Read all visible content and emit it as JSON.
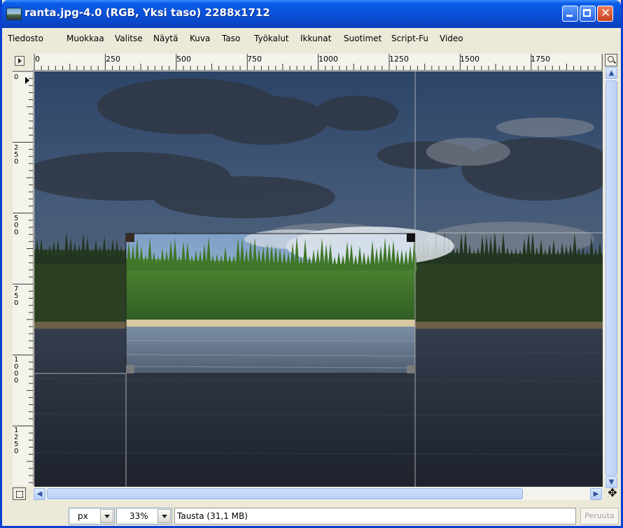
{
  "window": {
    "title": "ranta.jpg-4.0 (RGB, Yksi taso) 2288x1712"
  },
  "menu": [
    {
      "label": "Tiedosto"
    },
    {
      "label": "Muokkaa"
    },
    {
      "label": "Valitse"
    },
    {
      "label": "Näytä"
    },
    {
      "label": "Kuva"
    },
    {
      "label": "Taso"
    },
    {
      "label": "Työkalut"
    },
    {
      "label": "Ikkunat"
    },
    {
      "label": "Suotimet"
    },
    {
      "label": "Script-Fu"
    },
    {
      "label": "Video"
    }
  ],
  "rulers": {
    "horizontal": [
      "0",
      "250",
      "500",
      "750",
      "1000",
      "1250",
      "1500",
      "1750"
    ],
    "vertical": [
      "0",
      "250",
      "500",
      "750",
      "1000",
      "1250"
    ]
  },
  "status": {
    "unit": "px",
    "zoom": "33%",
    "message": "Tausta (31,1 MB)",
    "cancel_label": "Peruuta"
  },
  "icons": {
    "app": "image-icon",
    "minimize": "minimize-icon",
    "maximize": "maximize-icon",
    "close": "close-icon",
    "quick_mask": "quick-mask-icon",
    "zoom": "zoom-icon",
    "navigate": "navigate-icon"
  }
}
